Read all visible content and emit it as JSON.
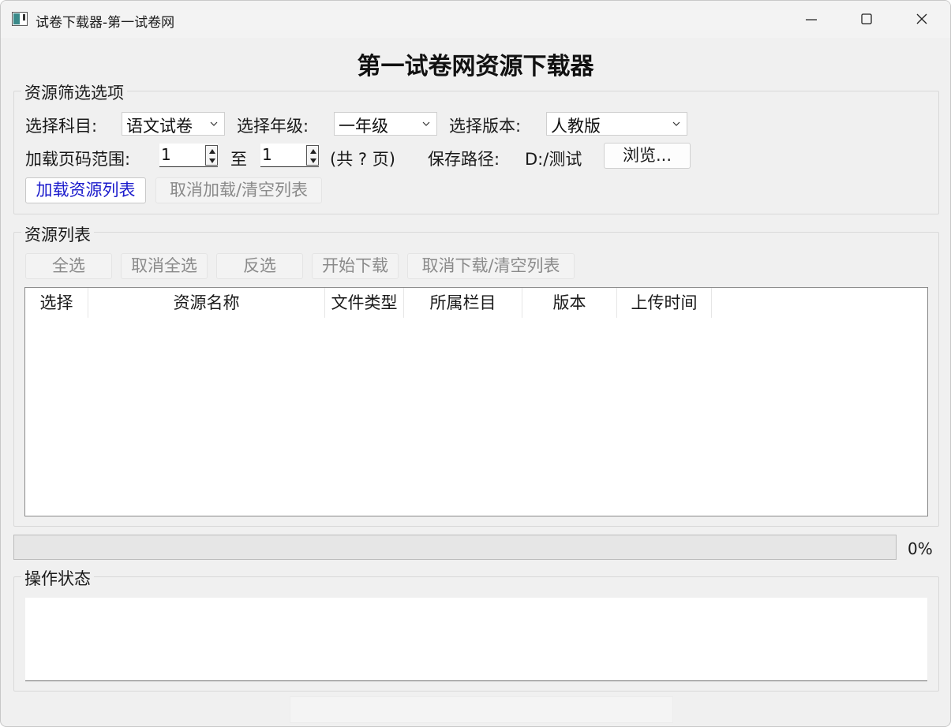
{
  "window": {
    "title": "试卷下载器-第一试卷网",
    "icon": "app-window-icon"
  },
  "main": {
    "title": "第一试卷网资源下载器"
  },
  "filter": {
    "group_title": "资源筛选选项",
    "subject_label": "选择科目:",
    "subject_value": "语文试卷",
    "grade_label": "选择年级:",
    "grade_value": "一年级",
    "edition_label": "选择版本:",
    "edition_value": "人教版",
    "page_range_label": "加载页码范围:",
    "page_from": "1",
    "to_label": "至",
    "page_to": "1",
    "total_pages": "(共 ? 页)",
    "save_path_label": "保存路径:",
    "save_path": "D:/测试",
    "browse_label": "浏览...",
    "load_label": "加载资源列表",
    "cancel_load_label": "取消加载/清空列表"
  },
  "resources": {
    "group_title": "资源列表",
    "select_all_label": "全选",
    "deselect_all_label": "取消全选",
    "invert_label": "反选",
    "start_download_label": "开始下载",
    "cancel_download_label": "取消下载/清空列表",
    "columns": [
      "选择",
      "资源名称",
      "文件类型",
      "所属栏目",
      "版本",
      "上传时间"
    ],
    "rows": []
  },
  "progress": {
    "value": 0,
    "text": "0%",
    "fill_color": "#2e9e3e"
  },
  "status": {
    "group_title": "操作状态",
    "log": ""
  }
}
